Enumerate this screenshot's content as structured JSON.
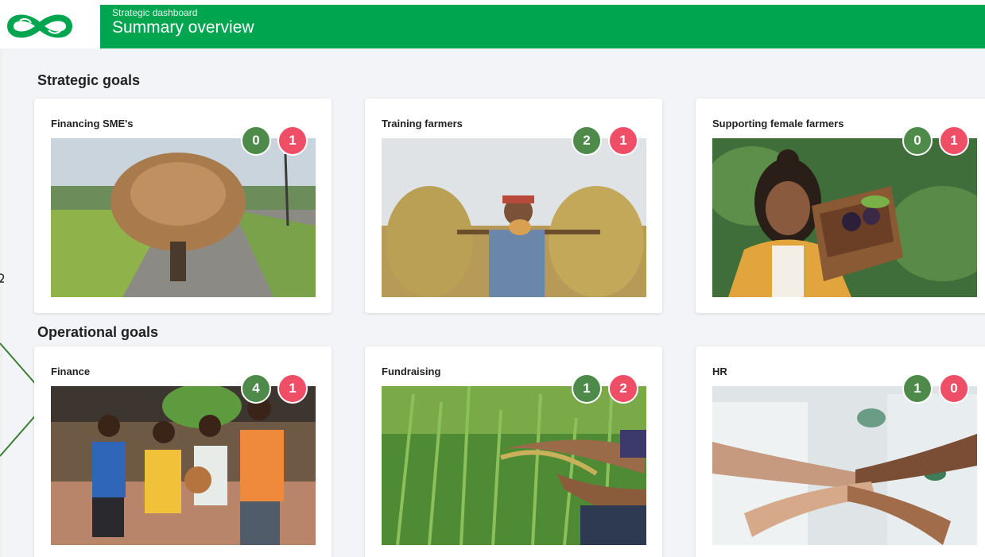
{
  "header": {
    "subtitle": "Strategic dashboard",
    "title": "Summary overview",
    "brand_color": "#00a550",
    "logo_icon": "infinity-leaf-logo-icon"
  },
  "sections": {
    "strategic": {
      "title": "Strategic goals",
      "cards": [
        {
          "title": "Financing SME's",
          "green_count": "0",
          "red_count": "1",
          "image": "bicycle-baskets-photo"
        },
        {
          "title": "Training farmers",
          "green_count": "2",
          "red_count": "1",
          "image": "farmers-rice-bundles-photo"
        },
        {
          "title": "Supporting female farmers",
          "green_count": "0",
          "red_count": "1",
          "image": "woman-vegetable-crate-photo"
        }
      ]
    },
    "operational": {
      "title": "Operational goals",
      "cards": [
        {
          "title": "Finance",
          "green_count": "4",
          "red_count": "1",
          "image": "children-football-photo"
        },
        {
          "title": "Fundraising",
          "green_count": "1",
          "red_count": "2",
          "image": "hand-rice-stalks-photo"
        },
        {
          "title": "HR",
          "green_count": "1",
          "red_count": "0",
          "image": "stacked-hands-photo"
        }
      ]
    }
  },
  "colors": {
    "badge_green": "#4e8a4a",
    "badge_red": "#ef4f66",
    "page_bg": "#f3f4f7"
  }
}
